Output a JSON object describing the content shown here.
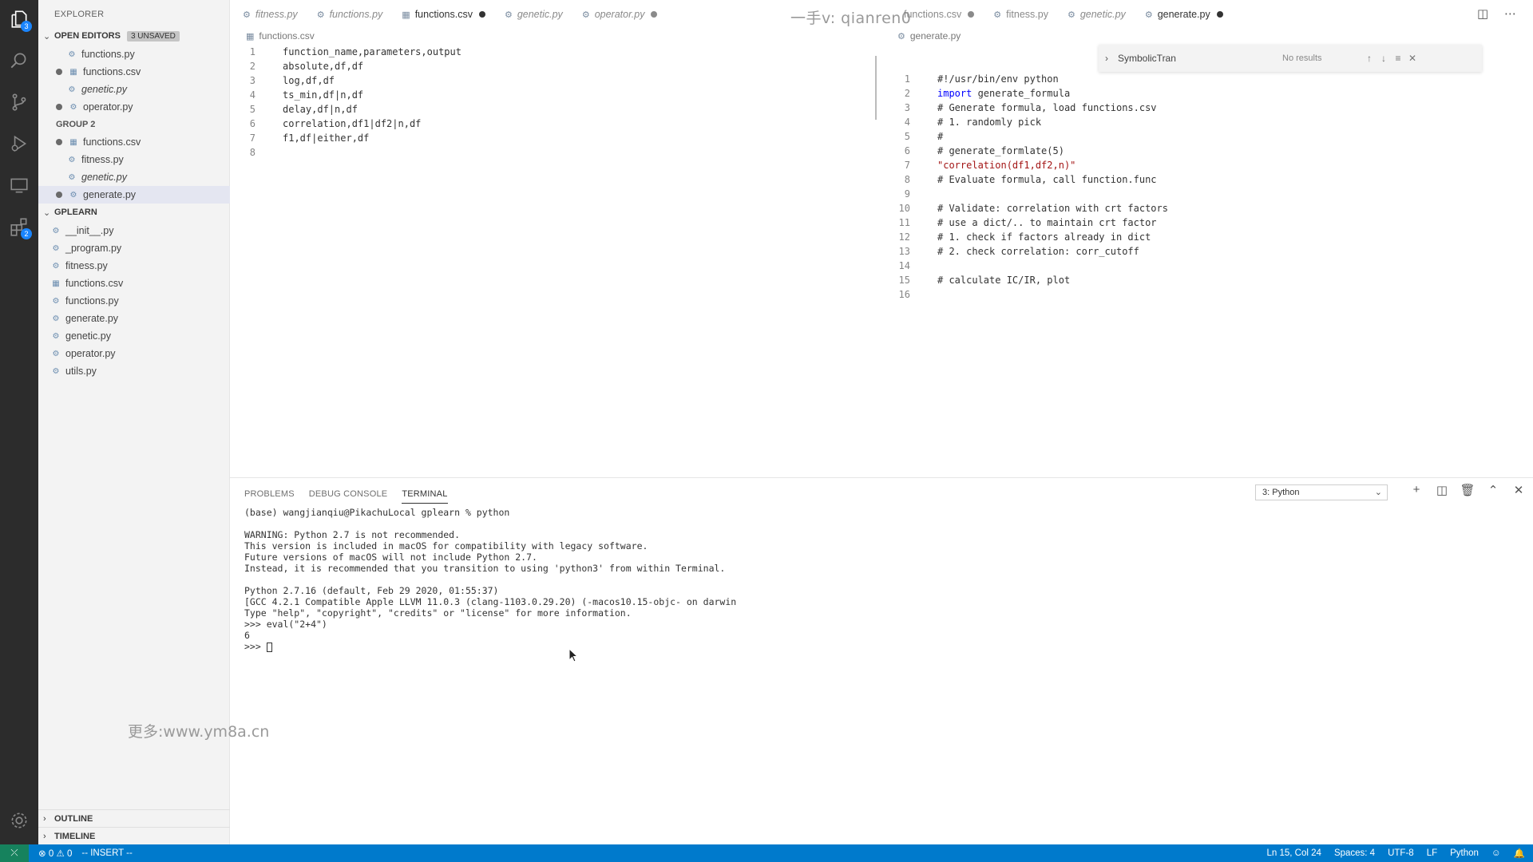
{
  "explorer": {
    "title": "EXPLORER",
    "open_editors": {
      "label": "OPEN EDITORS",
      "badge": "3 UNSAVED",
      "items": [
        {
          "name": "functions.py",
          "dirty": false
        },
        {
          "name": "functions.csv",
          "dirty": true
        },
        {
          "name": "genetic.py",
          "dirty": false
        },
        {
          "name": "operator.py",
          "dirty": true
        }
      ],
      "group2_label": "GROUP 2",
      "group2_items": [
        {
          "name": "functions.csv",
          "dirty": true
        },
        {
          "name": "fitness.py",
          "dirty": false
        },
        {
          "name": "genetic.py",
          "dirty": false
        },
        {
          "name": "generate.py",
          "dirty": true
        }
      ]
    },
    "project": {
      "label": "GPLEARN",
      "files": [
        "__init__.py",
        "_program.py",
        "fitness.py",
        "functions.csv",
        "functions.py",
        "generate.py",
        "genetic.py",
        "operator.py",
        "utils.py"
      ]
    },
    "outline_label": "OUTLINE",
    "timeline_label": "TIMELINE"
  },
  "editor_left": {
    "tabs": [
      {
        "name": "fitness.py",
        "italic": true,
        "dirty": false
      },
      {
        "name": "functions.py",
        "italic": true,
        "dirty": false
      },
      {
        "name": "functions.csv",
        "italic": false,
        "dirty": true,
        "active": true
      },
      {
        "name": "genetic.py",
        "italic": true,
        "dirty": false
      },
      {
        "name": "operator.py",
        "italic": true,
        "dirty": true
      }
    ],
    "breadcrumb": "functions.csv",
    "lines": [
      "function_name,parameters,output",
      "absolute,df,df",
      "log,df,df",
      "ts_min,df|n,df",
      "delay,df|n,df",
      "correlation,df1|df2|n,df",
      "f1,df|either,df",
      ""
    ]
  },
  "editor_right": {
    "tabs": [
      {
        "name": "functions.csv",
        "italic": false,
        "dirty": true
      },
      {
        "name": "fitness.py",
        "italic": false,
        "dirty": false
      },
      {
        "name": "genetic.py",
        "italic": true,
        "dirty": false
      },
      {
        "name": "generate.py",
        "italic": false,
        "dirty": true,
        "active": true
      }
    ],
    "breadcrumb": "generate.py",
    "lines": [
      "#!/usr/bin/env python",
      "import generate_formula",
      "# Generate formula, load functions.csv",
      "# 1. randomly pick",
      "#",
      "# generate_formlate(5)",
      "\"correlation(df1,df2,n)\"",
      "# Evaluate formula, call function.func",
      "",
      "# Validate: correlation with crt factors",
      "# use a dict/.. to maintain crt factor",
      "# 1. check if factors already in dict",
      "# 2. check correlation: corr_cutoff",
      "",
      "# calculate IC/IR, plot",
      ""
    ],
    "find_widget": {
      "value": "SymbolicTran",
      "status": "No results"
    }
  },
  "watermarks": {
    "top": "一手v: qianren0",
    "bottom": "更多:www.ym8a.cn"
  },
  "panel": {
    "tabs": [
      "PROBLEMS",
      "DEBUG CONSOLE",
      "TERMINAL"
    ],
    "active_tab": "TERMINAL",
    "terminal_select": "3: Python",
    "terminal_lines": [
      "(base) wangjianqiu@PikachuLocal gplearn % python",
      "",
      "WARNING: Python 2.7 is not recommended.",
      "This version is included in macOS for compatibility with legacy software.",
      "Future versions of macOS will not include Python 2.7.",
      "Instead, it is recommended that you transition to using 'python3' from within Terminal.",
      "",
      "Python 2.7.16 (default, Feb 29 2020, 01:55:37)",
      "[GCC 4.2.1 Compatible Apple LLVM 11.0.3 (clang-1103.0.29.20) (-macos10.15-objc- on darwin",
      "Type \"help\", \"copyright\", \"credits\" or \"license\" for more information.",
      ">>> eval(\"2+4\")",
      "6"
    ],
    "prompt": ">>> "
  },
  "activity_badges": {
    "explorer": "3",
    "extensions": "2"
  },
  "status_bar": {
    "errors": "0",
    "warnings": "0",
    "mode": "-- INSERT --",
    "position": "Ln 15, Col 24",
    "spaces": "Spaces: 4",
    "encoding": "UTF-8",
    "eol": "LF",
    "language": "Python"
  },
  "colors": {
    "accent": "#007acc",
    "activity": "#2c2c2c",
    "sidebar": "#f3f3f3",
    "remote": "#16825d"
  }
}
